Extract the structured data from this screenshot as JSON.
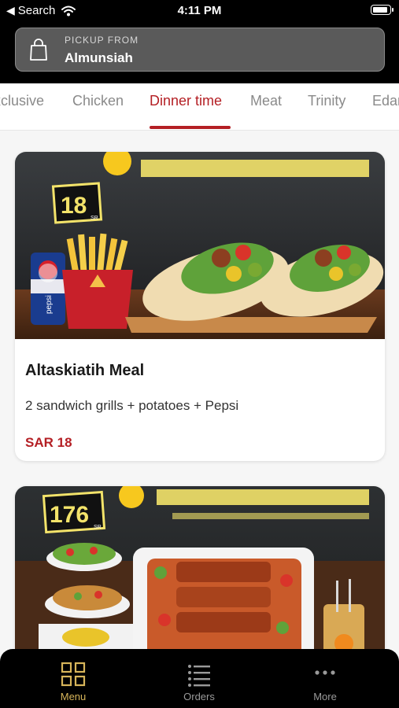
{
  "status_bar": {
    "back_label": "Search",
    "time": "4:11 PM"
  },
  "pickup": {
    "label": "PICKUP FROM",
    "value": "Almunsiah"
  },
  "tabs": [
    {
      "label": "Exclusive"
    },
    {
      "label": "Chicken"
    },
    {
      "label": "Dinner time",
      "active": true
    },
    {
      "label": "Meat"
    },
    {
      "label": "Trinity"
    },
    {
      "label": "Edam"
    }
  ],
  "items": [
    {
      "title": "Altaskiatih Meal",
      "description": "2 sandwich grills + potatoes + Pepsi",
      "price": "SAR 18",
      "image_badge": "18",
      "image_badge_unit": "SR",
      "pepsi_text": "pepsi"
    },
    {
      "image_badge": "176",
      "image_badge_unit": "SR"
    }
  ],
  "bottom_nav": [
    {
      "label": "Menu",
      "icon": "grid-icon",
      "active": true
    },
    {
      "label": "Orders",
      "icon": "list-icon"
    },
    {
      "label": "More",
      "icon": "more-dots-icon"
    }
  ],
  "colors": {
    "accent": "#b41f24",
    "nav_active": "#d7b55a",
    "header": "#000000"
  }
}
